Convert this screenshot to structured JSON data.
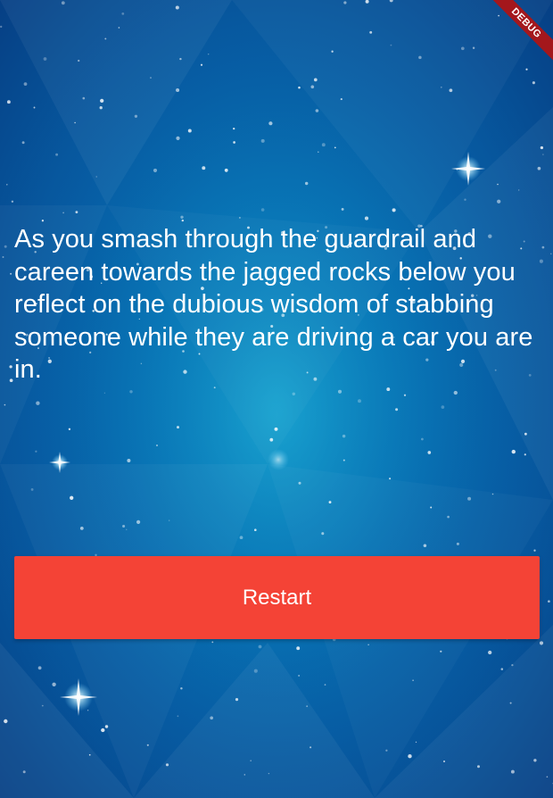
{
  "story": {
    "text": "As you smash through the guardrail and careen towards the jagged rocks below you reflect on the dubious wisdom of stabbing someone while they are driving a car you are in."
  },
  "actions": {
    "restart_label": "Restart"
  },
  "debug_banner": {
    "label": "DEBUG"
  },
  "colors": {
    "button": "#f44336",
    "background_center": "#0d8fc6",
    "background_edge": "#063f84",
    "banner": "#a4171c",
    "text": "#ffffff"
  }
}
